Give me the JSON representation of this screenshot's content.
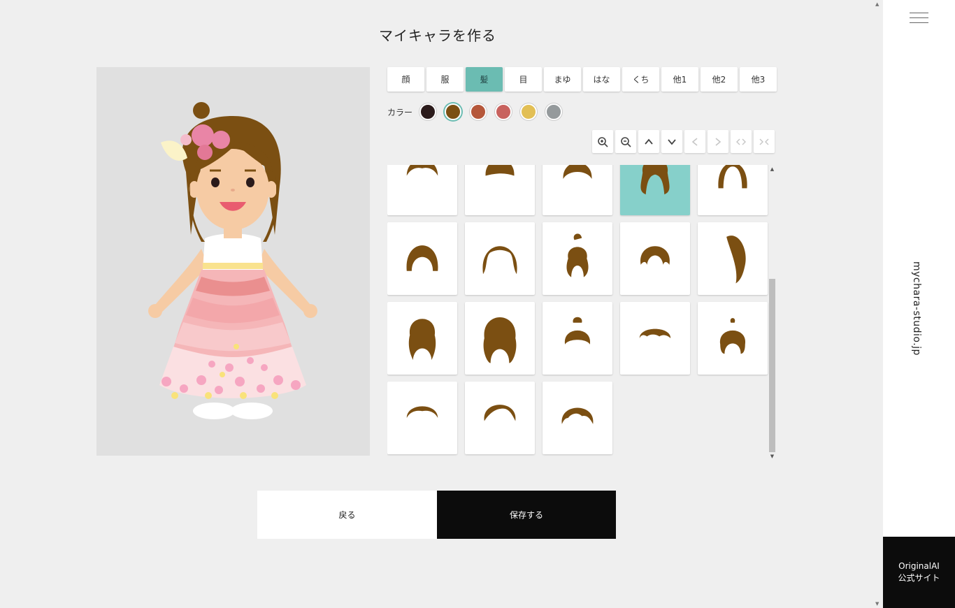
{
  "page": {
    "title": "マイキャラを作る"
  },
  "tabs": [
    {
      "label": "顔"
    },
    {
      "label": "服"
    },
    {
      "label": "髪"
    },
    {
      "label": "目"
    },
    {
      "label": "まゆ"
    },
    {
      "label": "はな"
    },
    {
      "label": "くち"
    },
    {
      "label": "他1"
    },
    {
      "label": "他2"
    },
    {
      "label": "他3"
    }
  ],
  "active_tab": "髪",
  "colors": {
    "label": "カラー",
    "swatches": [
      "#2b1b1b",
      "#7b4f12",
      "#b5573a",
      "#c8625e",
      "#e2bf55",
      "#959a9c"
    ],
    "selected": "#7b4f12"
  },
  "controls": [
    {
      "icon": "zoom-in-icon",
      "enabled": true
    },
    {
      "icon": "zoom-out-icon",
      "enabled": true
    },
    {
      "icon": "chevron-up-icon",
      "enabled": true
    },
    {
      "icon": "chevron-down-icon",
      "enabled": true
    },
    {
      "icon": "chevron-left-icon",
      "enabled": false
    },
    {
      "icon": "chevron-right-icon",
      "enabled": false
    },
    {
      "icon": "expand-horizontal-icon",
      "enabled": false
    },
    {
      "icon": "shrink-horizontal-icon",
      "enabled": false
    }
  ],
  "hair_color": "#7b4f12",
  "accent_color": "#6bbcb2",
  "hairstyles_selected_index": 3,
  "buttons": {
    "back": "戻る",
    "save": "保存する"
  },
  "sidebar": {
    "site_name": "mychara-studio.jp",
    "official_line1": "OriginalAI",
    "official_line2": "公式サイト"
  }
}
